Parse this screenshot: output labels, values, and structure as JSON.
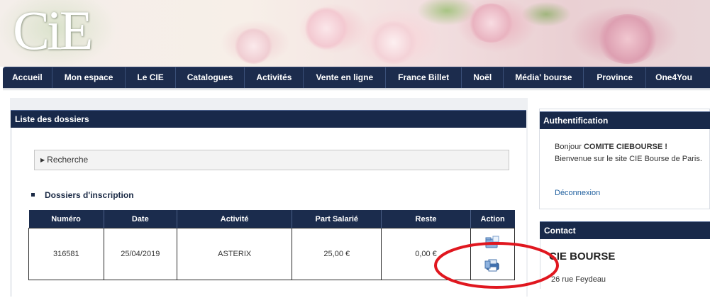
{
  "banner": {
    "logo_text": "CiE"
  },
  "nav": {
    "items": [
      {
        "label": "Accueil"
      },
      {
        "label": "Mon espace"
      },
      {
        "label": "Le CIE"
      },
      {
        "label": "Catalogues"
      },
      {
        "label": "Activités"
      },
      {
        "label": "Vente en ligne"
      },
      {
        "label": "France Billet"
      },
      {
        "label": "Noël"
      },
      {
        "label": "Média' bourse"
      },
      {
        "label": "Province"
      },
      {
        "label": "One4You"
      }
    ]
  },
  "main": {
    "title": "Liste des dossiers",
    "search_label": "Recherche",
    "section_title": "Dossiers d'inscription",
    "table": {
      "headers": [
        "Numéro",
        "Date",
        "Activité",
        "Part Salarié",
        "Reste",
        "Action"
      ],
      "rows": [
        {
          "numero": "316581",
          "date": "25/04/2019",
          "activite": "ASTERIX",
          "part_salarie": "25,00 €",
          "reste": "0,00 €",
          "actions": [
            "edit-folder-icon",
            "print-icon"
          ]
        }
      ]
    }
  },
  "sidebar": {
    "auth": {
      "title": "Authentification",
      "greeting_prefix": "Bonjour ",
      "user_name": "COMITE CIEBOURSE !",
      "welcome": "Bienvenue sur le site CIE Bourse de Paris.",
      "logout_label": "Déconnexion"
    },
    "contact": {
      "title": "Contact",
      "name": "CIE BOURSE",
      "address": "26 rue Feydeau"
    }
  },
  "colors": {
    "nav_bg": "#1c2c4d",
    "header_bg": "#18294a",
    "link": "#1f5f9e",
    "annotation": "#e0171f"
  }
}
